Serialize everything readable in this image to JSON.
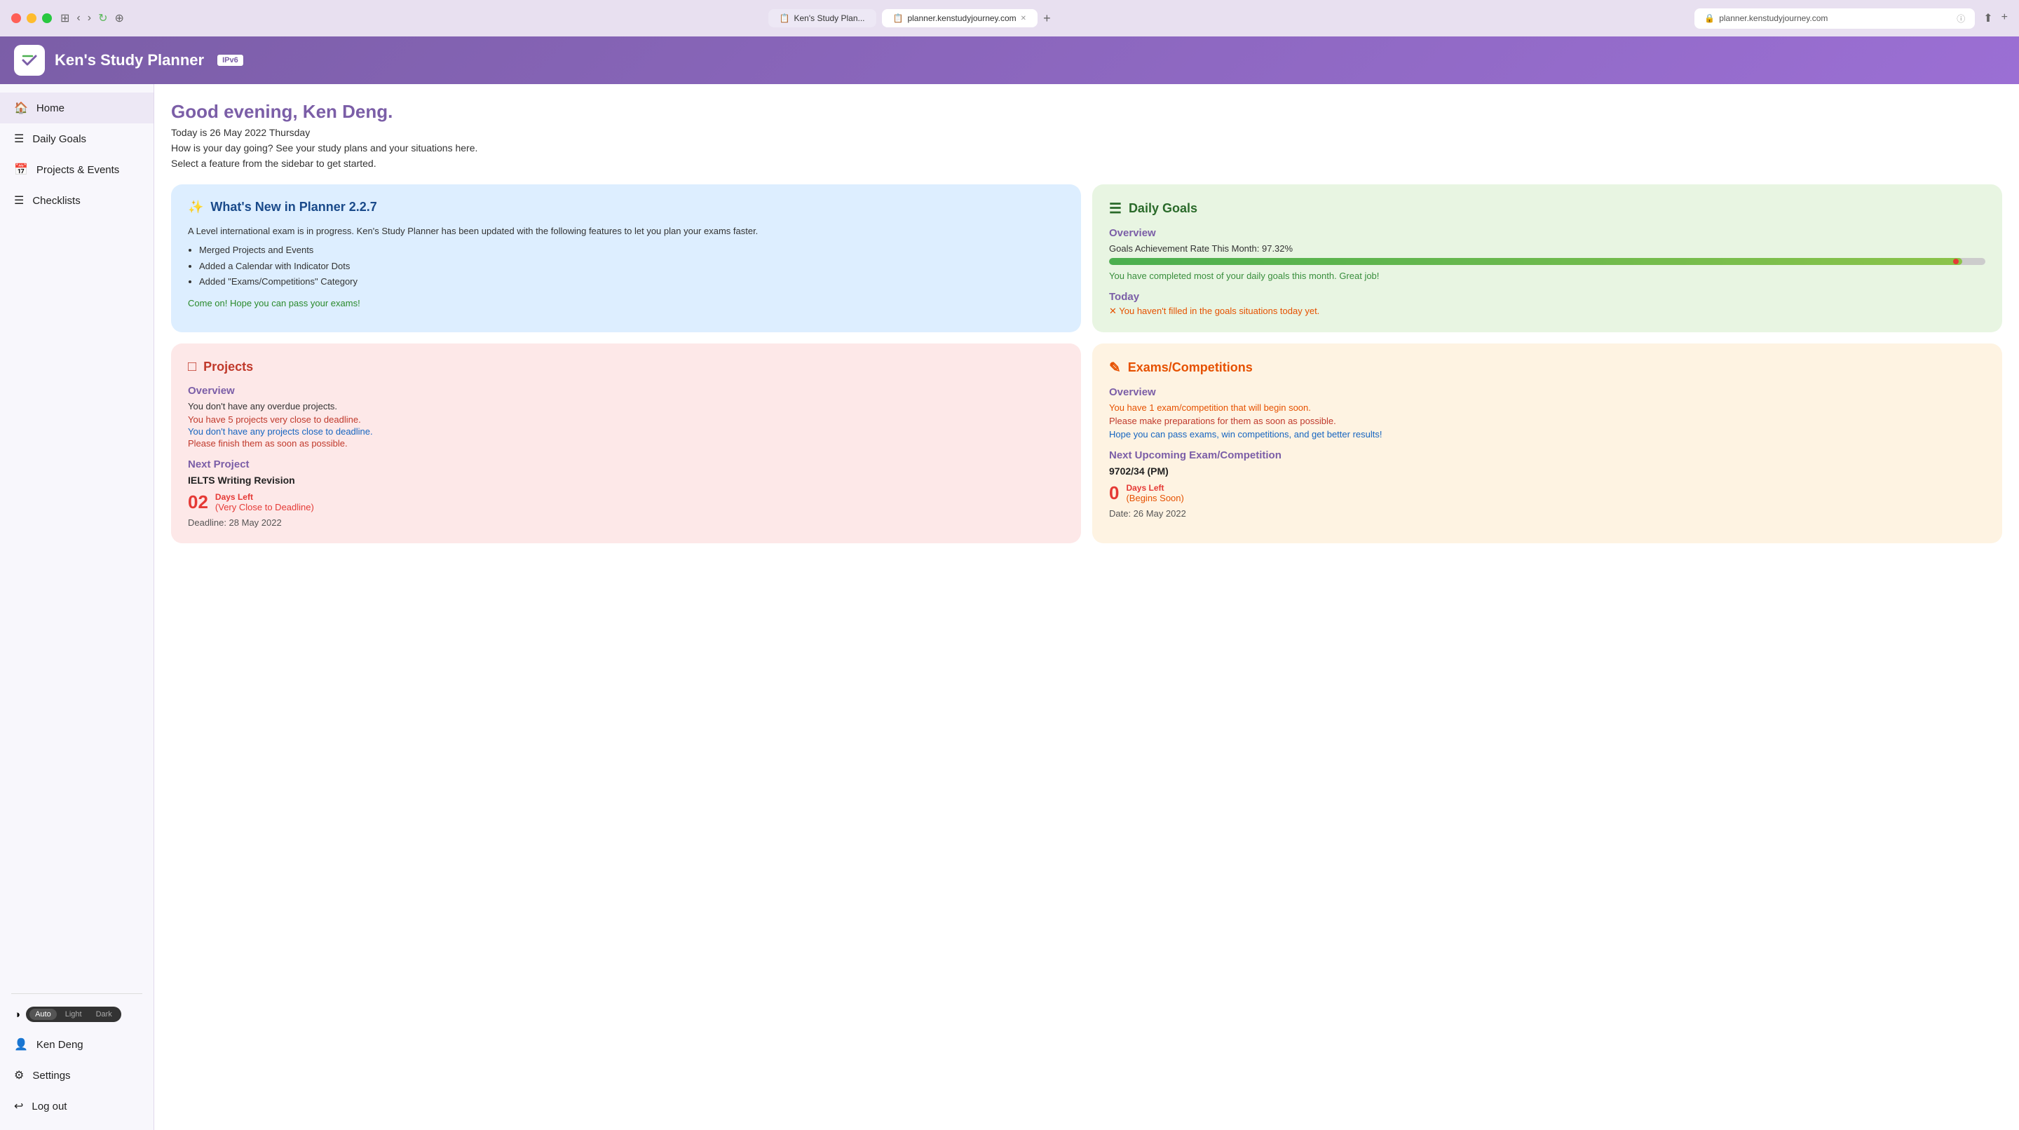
{
  "browser": {
    "tab1": {
      "label": "Ken's Study Plan...",
      "icon": "📋"
    },
    "tab2": {
      "label": "planner.kenstudyjourney.com",
      "icon": "🔒"
    },
    "address": "planner.kenstudyjourney.com"
  },
  "header": {
    "app_name": "Ken's Study Planner",
    "ipv6_badge": "IPv6"
  },
  "sidebar": {
    "items": [
      {
        "id": "home",
        "label": "Home",
        "icon": "🏠"
      },
      {
        "id": "daily-goals",
        "label": "Daily Goals",
        "icon": "☰"
      },
      {
        "id": "projects-events",
        "label": "Projects & Events",
        "icon": "📅"
      },
      {
        "id": "checklists",
        "label": "Checklists",
        "icon": "☰"
      }
    ],
    "theme": {
      "icon": "◑",
      "options": [
        "Auto",
        "Light",
        "Dark"
      ],
      "active": "Auto"
    },
    "user": {
      "label": "Ken Deng",
      "icon": "👤"
    },
    "settings": {
      "label": "Settings",
      "icon": "⚙"
    },
    "logout": {
      "label": "Log out",
      "icon": "↩"
    }
  },
  "content": {
    "greeting": "Good evening, Ken Deng.",
    "date": "Today is 26 May 2022 Thursday",
    "how": "How is your day going? See your study plans and your situations here.",
    "select": "Select a feature from the sidebar to get started."
  },
  "whats_new_card": {
    "icon": "✨",
    "title": "What's New in Planner 2.2.7",
    "body": "A Level international exam is in progress. Ken's Study Planner has been updated with the following features to let you plan your exams faster.",
    "bullets": [
      "Merged Projects and Events",
      "Added a Calendar with Indicator Dots",
      "Added \"Exams/Competitions\" Category"
    ],
    "link": "Come on! Hope you can pass your exams!"
  },
  "daily_goals_card": {
    "icon": "☰",
    "title": "Daily Goals",
    "overview_label": "Overview",
    "rate_text": "Goals Achievement Rate This Month: 97.32%",
    "progress_percent": 97.32,
    "praise": "You have completed most of your daily goals this month. Great job!",
    "today_label": "Today",
    "today_warning": "✕ You haven't filled in the goals situations today yet."
  },
  "projects_card": {
    "icon": "□",
    "title": "Projects",
    "overview_label": "Overview",
    "no_overdue": "You don't have any overdue projects.",
    "warning1": "You have 5 projects very close to deadline.",
    "info1": "You don't have any projects close to deadline.",
    "warning2": "Please finish them as soon as possible.",
    "next_label": "Next Project",
    "project_name": "IELTS Writing Revision",
    "days_left": "02",
    "days_left_label": "Days Left",
    "very_close": "(Very Close to Deadline)",
    "deadline": "Deadline: 28 May 2022"
  },
  "exams_card": {
    "icon": "✎",
    "title": "Exams/Competitions",
    "overview_label": "Overview",
    "exam_orange": "You have 1 exam/competition that will begin soon.",
    "exam_red": "Please make preparations for them as soon as possible.",
    "exam_blue": "Hope you can pass exams, win competitions, and get better results!",
    "next_label": "Next Upcoming Exam/Competition",
    "exam_name": "9702/34 (PM)",
    "days_left": "0",
    "days_left_label": "Days Left",
    "begins_soon": "(Begins Soon)",
    "date": "Date: 26 May 2022"
  }
}
